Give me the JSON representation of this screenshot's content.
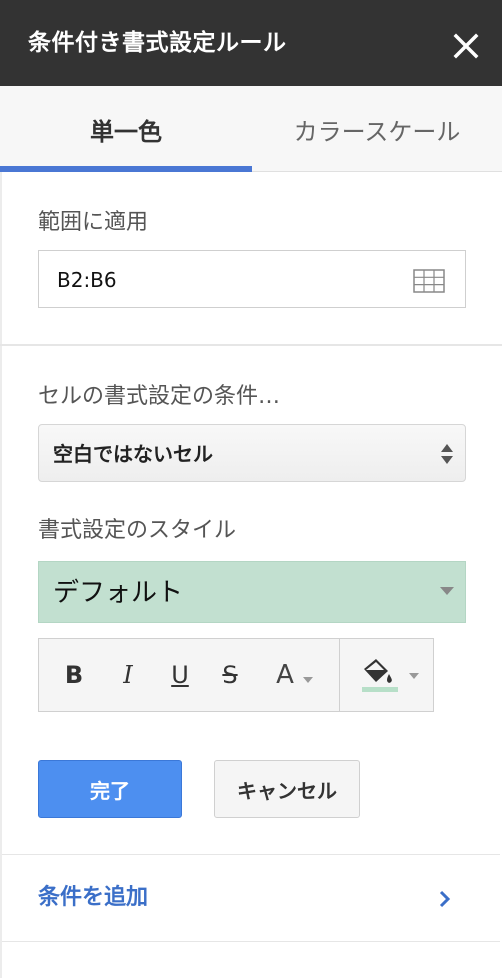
{
  "header": {
    "title": "条件付き書式設定ルール",
    "close_icon": "close-icon"
  },
  "tabs": [
    {
      "label": "単一色",
      "active": true
    },
    {
      "label": "カラースケール",
      "active": false
    }
  ],
  "range": {
    "label": "範囲に適用",
    "value": "B2:B6",
    "icon": "grid-select-icon"
  },
  "condition": {
    "label": "セルの書式設定の条件…",
    "selected": "空白ではないセル"
  },
  "style": {
    "label": "書式設定のスタイル",
    "selected": "デフォルト",
    "preview_color": "#c2e0d0"
  },
  "toolbar": {
    "bold": "B",
    "italic": "I",
    "underline": "U",
    "strikethrough": "S",
    "text_color": "A",
    "fill_underline_color": "#b7dfc8"
  },
  "buttons": {
    "done": "完了",
    "cancel": "キャンセル"
  },
  "add_condition": {
    "label": "条件を追加"
  },
  "colors": {
    "accent": "#4a77d4",
    "header_bg": "#333333",
    "link": "#3b6fc8"
  }
}
